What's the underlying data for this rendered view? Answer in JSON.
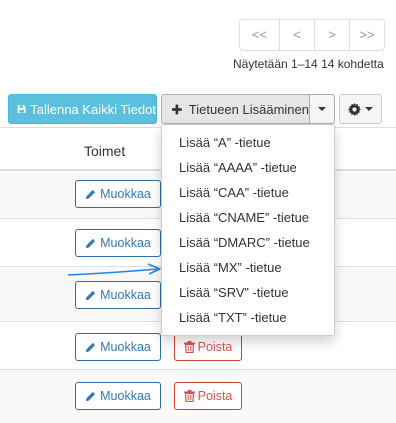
{
  "pager": {
    "first": "<<",
    "prev": "<",
    "next": ">",
    "last": ">>"
  },
  "showing_text": "Näytetään 1–14 14 kohdetta",
  "toolbar": {
    "save_all_label": "Tallenna Kaikki Tiedot",
    "add_record_label": "Tietueen Lisääminen"
  },
  "table": {
    "actions_header": "Toimet",
    "edit_label": "Muokkaa",
    "delete_label": "Poista"
  },
  "dropdown": {
    "items": [
      "Lisää “A” -tietue",
      "Lisää “AAAA” -tietue",
      "Lisää “CAA” -tietue",
      "Lisää “CNAME” -tietue",
      "Lisää “DMARC” -tietue",
      "Lisää “MX” -tietue",
      "Lisää “SRV” -tietue",
      "Lisää “TXT” -tietue"
    ]
  },
  "colors": {
    "info": "#5bc0de",
    "primary": "#337ab7",
    "danger": "#d9534f",
    "annotation_arrow": "#1e88e5"
  },
  "icons": {
    "save": "floppy-disk-icon",
    "add": "plus-icon",
    "settings": "gear-icon",
    "edit": "pencil-icon",
    "delete": "trash-icon"
  }
}
